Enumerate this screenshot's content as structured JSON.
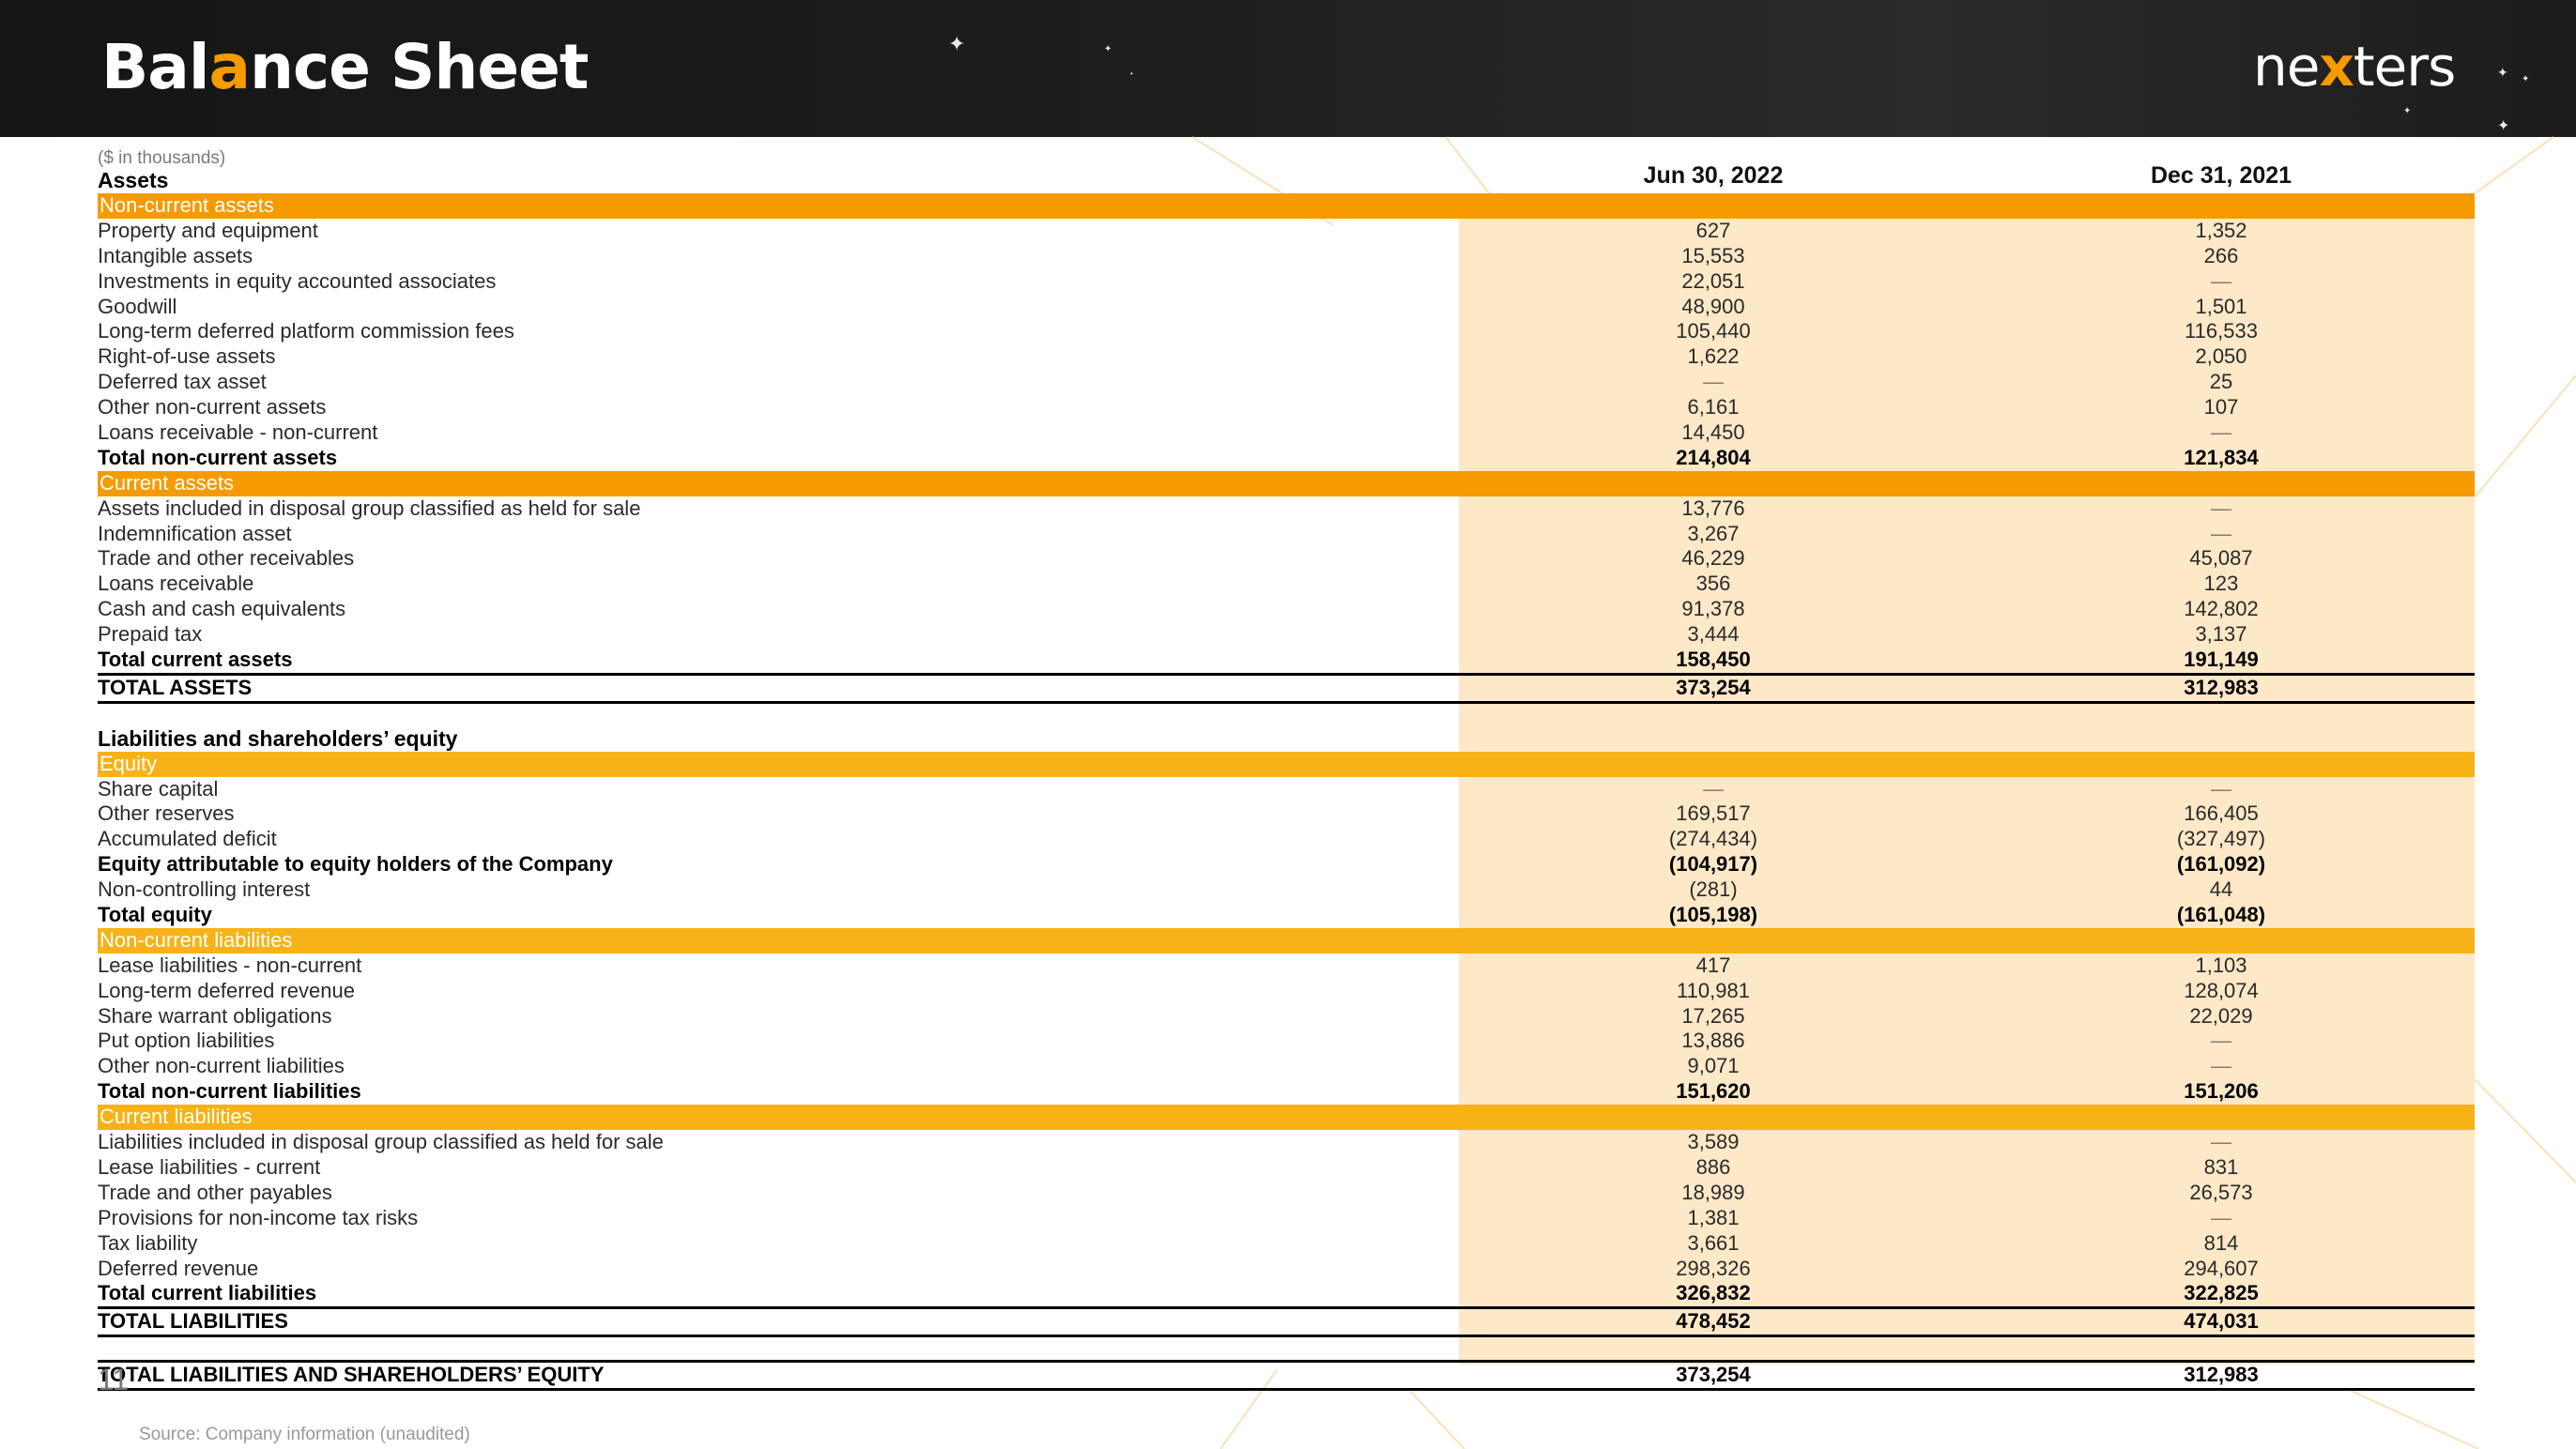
{
  "header": {
    "title_prefix": "Bal",
    "title_accent": "a",
    "title_suffix": "nce Sheet",
    "logo_prefix": "ne",
    "logo_accent": "x",
    "logo_suffix": "ters"
  },
  "colors": {
    "accent_orange": "#f59b00",
    "section_orange_light": "#f7b217",
    "column_beige": "#fde8c8",
    "header_dark": "#1e1e1e"
  },
  "table": {
    "units": "($ in thousands)",
    "columns": [
      "Jun 30, 2022",
      "Dec 31, 2021"
    ],
    "rows": [
      {
        "type": "heading",
        "label": "Assets",
        "v1": "",
        "v2": ""
      },
      {
        "type": "section",
        "label": "Non-current assets",
        "v1": "",
        "v2": ""
      },
      {
        "type": "item",
        "label": "Property and equipment",
        "v1": "627",
        "v2": "1,352"
      },
      {
        "type": "item",
        "label": "Intangible assets",
        "v1": "15,553",
        "v2": "266"
      },
      {
        "type": "item",
        "label": "Investments in equity accounted associates",
        "v1": "22,051",
        "v2": "—"
      },
      {
        "type": "item",
        "label": "Goodwill",
        "v1": "48,900",
        "v2": "1,501"
      },
      {
        "type": "item",
        "label": "Long-term deferred platform commission fees",
        "v1": "105,440",
        "v2": "116,533"
      },
      {
        "type": "item",
        "label": "Right-of-use assets",
        "v1": "1,622",
        "v2": "2,050"
      },
      {
        "type": "item",
        "label": "Deferred tax asset",
        "v1": "—",
        "v2": "25"
      },
      {
        "type": "item",
        "label": "Other non-current assets",
        "v1": "6,161",
        "v2": "107"
      },
      {
        "type": "item",
        "label": "Loans receivable - non-current",
        "v1": "14,450",
        "v2": "—"
      },
      {
        "type": "total",
        "label": "Total non-current assets",
        "v1": "214,804",
        "v2": "121,834"
      },
      {
        "type": "section",
        "label": "Current assets",
        "v1": "",
        "v2": ""
      },
      {
        "type": "item",
        "label": "Assets included in disposal group classified as held for sale",
        "v1": "13,776",
        "v2": "—"
      },
      {
        "type": "item",
        "label": "Indemnification asset",
        "v1": "3,267",
        "v2": "—"
      },
      {
        "type": "item",
        "label": "Trade and other receivables",
        "v1": "46,229",
        "v2": "45,087"
      },
      {
        "type": "item",
        "label": "Loans receivable",
        "v1": "356",
        "v2": "123"
      },
      {
        "type": "item",
        "label": "Cash and cash equivalents",
        "v1": "91,378",
        "v2": "142,802"
      },
      {
        "type": "item",
        "label": "Prepaid tax",
        "v1": "3,444",
        "v2": "3,137"
      },
      {
        "type": "total",
        "label": "Total current assets",
        "v1": "158,450",
        "v2": "191,149"
      },
      {
        "type": "grand",
        "label": "TOTAL ASSETS",
        "v1": "373,254",
        "v2": "312,983"
      },
      {
        "type": "spacer",
        "label": "",
        "v1": "",
        "v2": ""
      },
      {
        "type": "heading",
        "label": "Liabilities and shareholders’ equity",
        "v1": "",
        "v2": ""
      },
      {
        "type": "section-l",
        "label": "Equity",
        "v1": "",
        "v2": ""
      },
      {
        "type": "item",
        "label": "Share capital",
        "v1": "—",
        "v2": "—"
      },
      {
        "type": "item",
        "label": "Other reserves",
        "v1": "169,517",
        "v2": "166,405"
      },
      {
        "type": "item",
        "label": "Accumulated deficit",
        "v1": "(274,434)",
        "v2": "(327,497)"
      },
      {
        "type": "total",
        "label": "Equity attributable to equity holders of the Company",
        "v1": "(104,917)",
        "v2": "(161,092)"
      },
      {
        "type": "item",
        "label": "Non-controlling interest",
        "v1": "(281)",
        "v2": "44"
      },
      {
        "type": "total",
        "label": "Total equity",
        "v1": "(105,198)",
        "v2": "(161,048)"
      },
      {
        "type": "section-l",
        "label": "Non-current liabilities",
        "v1": "",
        "v2": ""
      },
      {
        "type": "item",
        "label": "Lease liabilities - non-current",
        "v1": "417",
        "v2": "1,103"
      },
      {
        "type": "item",
        "label": "Long-term deferred revenue",
        "v1": "110,981",
        "v2": "128,074"
      },
      {
        "type": "item",
        "label": "Share warrant obligations",
        "v1": "17,265",
        "v2": "22,029"
      },
      {
        "type": "item",
        "label": "Put option liabilities",
        "v1": "13,886",
        "v2": "—"
      },
      {
        "type": "item",
        "label": "Other non-current liabilities",
        "v1": "9,071",
        "v2": "—"
      },
      {
        "type": "total",
        "label": "Total non-current liabilities",
        "v1": "151,620",
        "v2": "151,206"
      },
      {
        "type": "section-l",
        "label": "Current liabilities",
        "v1": "",
        "v2": ""
      },
      {
        "type": "item",
        "label": "Liabilities included in disposal group classified as held for sale",
        "v1": "3,589",
        "v2": "—"
      },
      {
        "type": "item",
        "label": "Lease liabilities - current",
        "v1": "886",
        "v2": "831"
      },
      {
        "type": "item",
        "label": "Trade and other payables",
        "v1": "18,989",
        "v2": "26,573"
      },
      {
        "type": "item",
        "label": "Provisions for non-income tax risks",
        "v1": "1,381",
        "v2": "—"
      },
      {
        "type": "item",
        "label": "Tax liability",
        "v1": "3,661",
        "v2": "814"
      },
      {
        "type": "item",
        "label": "Deferred revenue",
        "v1": "298,326",
        "v2": "294,607"
      },
      {
        "type": "total",
        "label": "Total current liabilities",
        "v1": "326,832",
        "v2": "322,825"
      },
      {
        "type": "grand",
        "label": "TOTAL LIABILITIES",
        "v1": "478,452",
        "v2": "474,031"
      },
      {
        "type": "spacer",
        "label": "",
        "v1": "",
        "v2": ""
      },
      {
        "type": "grand",
        "label": "TOTAL LIABILITIES AND SHAREHOLDERS’ EQUITY",
        "v1": "373,254",
        "v2": "312,983"
      }
    ]
  },
  "footer": {
    "page_number": "11",
    "source": "Source: Company information (unaudited)"
  }
}
